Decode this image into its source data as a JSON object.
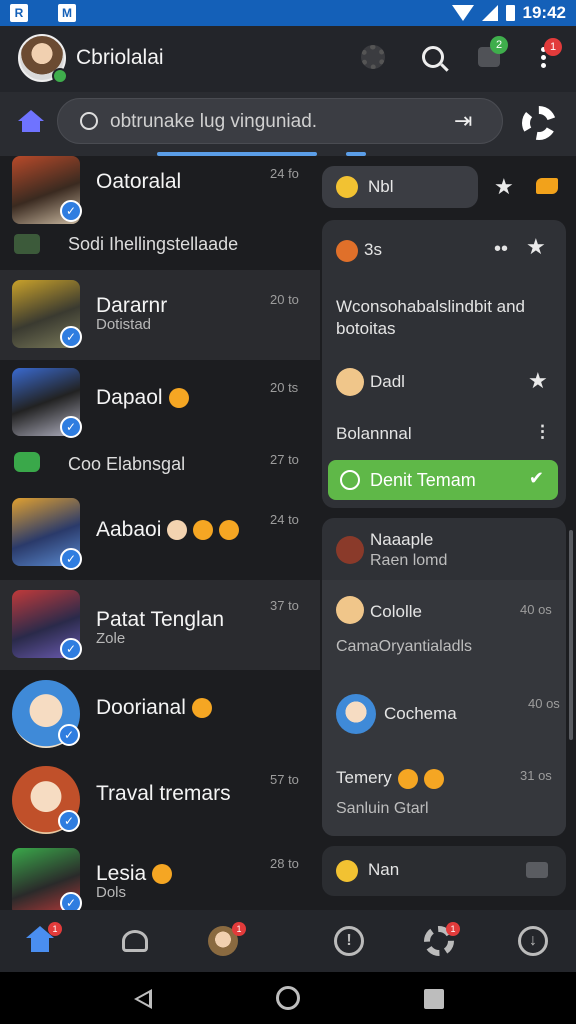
{
  "status_bar": {
    "time": "19:42"
  },
  "header": {
    "title": "Cbriolalai",
    "notification_count": "2",
    "alert_badge": "1"
  },
  "search": {
    "placeholder": "obtrunake lug vinguniad."
  },
  "chats": [
    {
      "name": "Oatoralal",
      "subtitle": "",
      "time": "24 fo"
    },
    {
      "name": "Dararnr",
      "subtitle": "Dotistad",
      "time": "20 to"
    },
    {
      "name": "Dapaol",
      "subtitle": "",
      "time": "20 ts"
    },
    {
      "name": "Aabaoi",
      "subtitle": "",
      "time": "24 to"
    },
    {
      "name": "Patat Tenglan",
      "subtitle": "Zole",
      "time": "37 to"
    },
    {
      "name": "Doorianal",
      "subtitle": "",
      "time": ""
    },
    {
      "name": "Traval tremars",
      "subtitle": "",
      "time": "57 to"
    },
    {
      "name": "Lesia",
      "subtitle": "Dols",
      "time": "28 to"
    }
  ],
  "list_labels": {
    "group_1": "Sodi Ihellingstellaade",
    "group_2": "Coo Elabnsgal"
  },
  "panel": {
    "chip_label": "Nbl",
    "card1": {
      "header": "3s",
      "description": "Wconsohabalslindbit and botoitas",
      "item_name": "Dadl",
      "item_sub": "Bolannnal",
      "button_label": "Denit Temam"
    },
    "card2": {
      "title": "Naaaple",
      "subtitle": "Raen lomd",
      "item1_name": "Cololle",
      "item1_time": "40 os",
      "item1_sub": "CamaOryantialadls",
      "item2_name": "Cochema",
      "item2_time": "40 os",
      "item3_name": "Temery",
      "item3_time": "31 os",
      "item3_sub": "Sanluin Gtarl"
    },
    "footer_label": "Nan"
  },
  "bottom_nav": {
    "home_badge": "1",
    "profile_badge": "1",
    "alerts_badge": "1"
  }
}
